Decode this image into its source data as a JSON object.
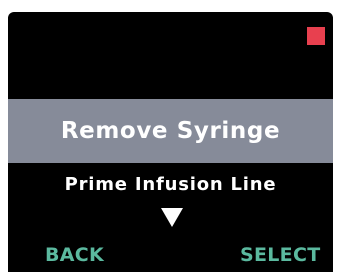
{
  "colors": {
    "screen_background": "#000000",
    "highlight_bar": "#868b99",
    "menu_text": "#ffffff",
    "softkey_text": "#5bb99f",
    "status_indicator": "#e8404f"
  },
  "menu": {
    "selected_item": "Remove Syringe",
    "next_item": "Prime Infusion Line",
    "scroll_icon": "triangle-down-icon"
  },
  "status": {
    "indicator_icon": "red-square-indicator"
  },
  "softkeys": {
    "left_label": "BACK",
    "right_label": "SELECT"
  }
}
